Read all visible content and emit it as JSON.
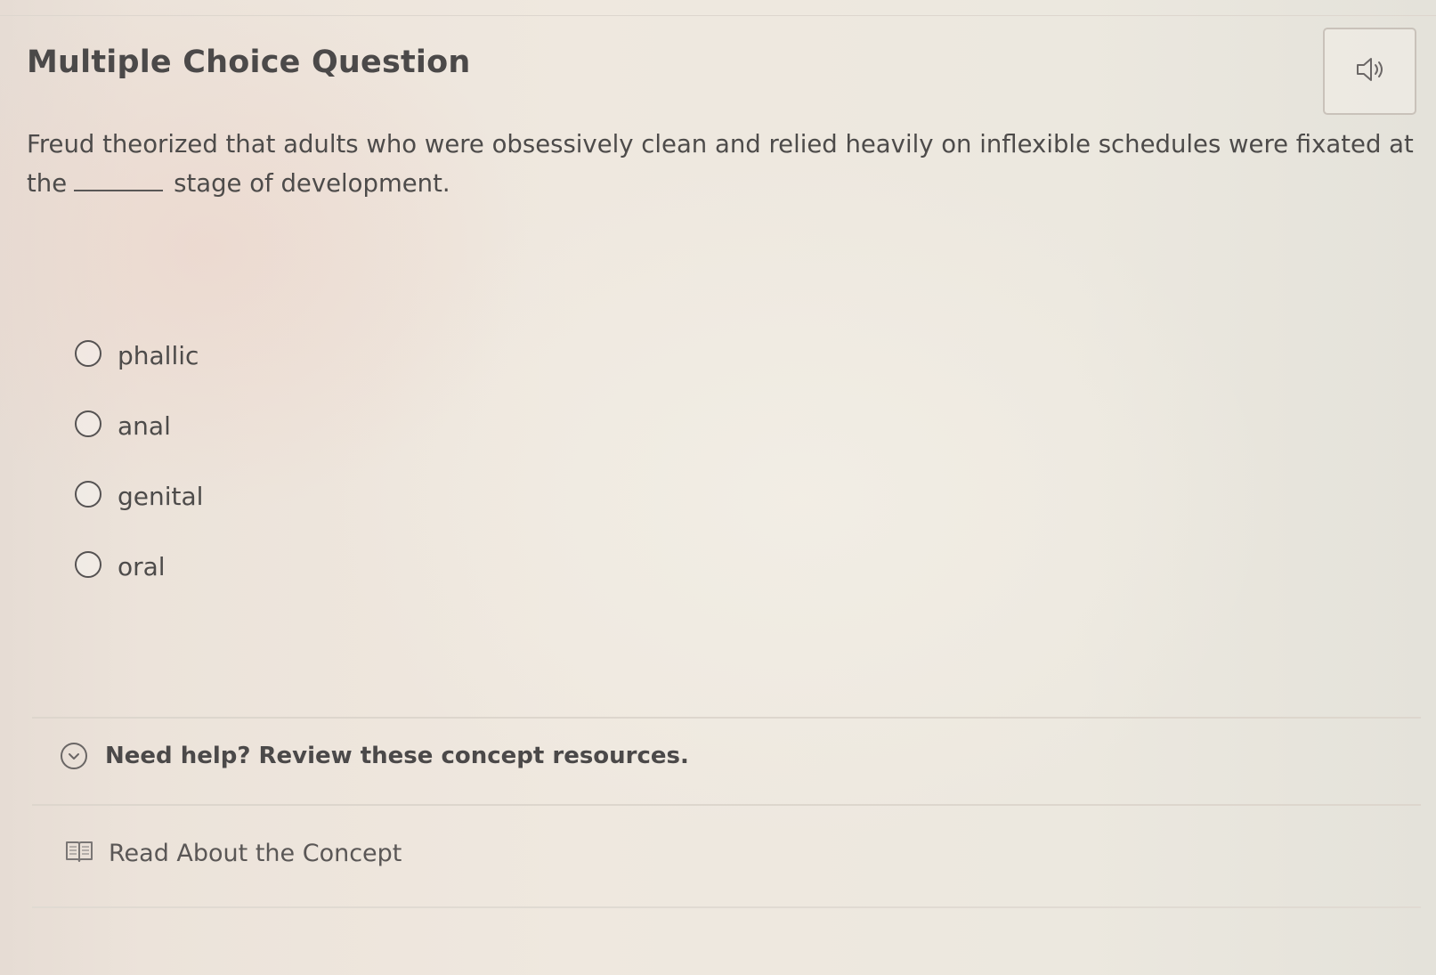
{
  "question": {
    "heading": "Multiple Choice Question",
    "prompt_before": "Freud theorized that adults who were obsessively clean and relied heavily on inflexible schedules were fixated at the",
    "prompt_after": "stage of development."
  },
  "audio": {
    "icon": "speaker-icon"
  },
  "options": [
    {
      "label": "phallic",
      "selected": false
    },
    {
      "label": "anal",
      "selected": false
    },
    {
      "label": "genital",
      "selected": false
    },
    {
      "label": "oral",
      "selected": false
    }
  ],
  "help": {
    "label": "Need help? Review these concept resources.",
    "icon": "chevron-down-icon"
  },
  "resources": {
    "read_label": "Read About the Concept",
    "icon": "book-icon"
  }
}
